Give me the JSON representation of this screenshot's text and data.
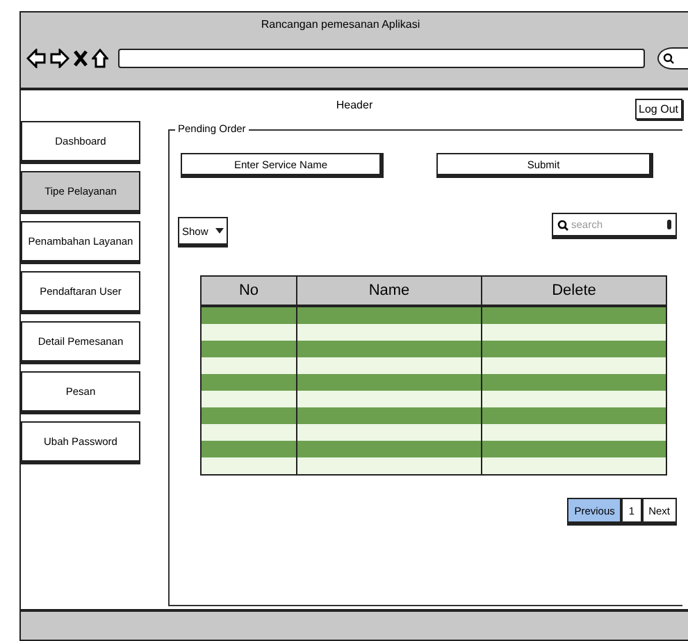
{
  "window": {
    "title": "Rancangan pemesanan Aplikasi"
  },
  "header": {
    "title": "Header",
    "logout": "Log Out"
  },
  "sidebar": {
    "items": [
      {
        "label": "Dashboard",
        "selected": false
      },
      {
        "label": "Tipe Pelayanan",
        "selected": true
      },
      {
        "label": "Penambahan Layanan",
        "selected": false
      },
      {
        "label": "Pendaftaran User",
        "selected": false
      },
      {
        "label": "Detail Pemesanan",
        "selected": false
      },
      {
        "label": "Pesan",
        "selected": false
      },
      {
        "label": "Ubah Password",
        "selected": false
      }
    ]
  },
  "panel": {
    "title": "Pending Order",
    "service_button": "Enter Service Name",
    "submit_button": "Submit",
    "show_dropdown": "Show",
    "search": {
      "placeholder": "search"
    },
    "table": {
      "columns": [
        "No",
        "Name",
        "Delete"
      ]
    },
    "pagination": [
      {
        "label": "Previous",
        "selected": true
      },
      {
        "label": "1",
        "selected": false
      },
      {
        "label": "Next",
        "selected": false
      }
    ]
  }
}
